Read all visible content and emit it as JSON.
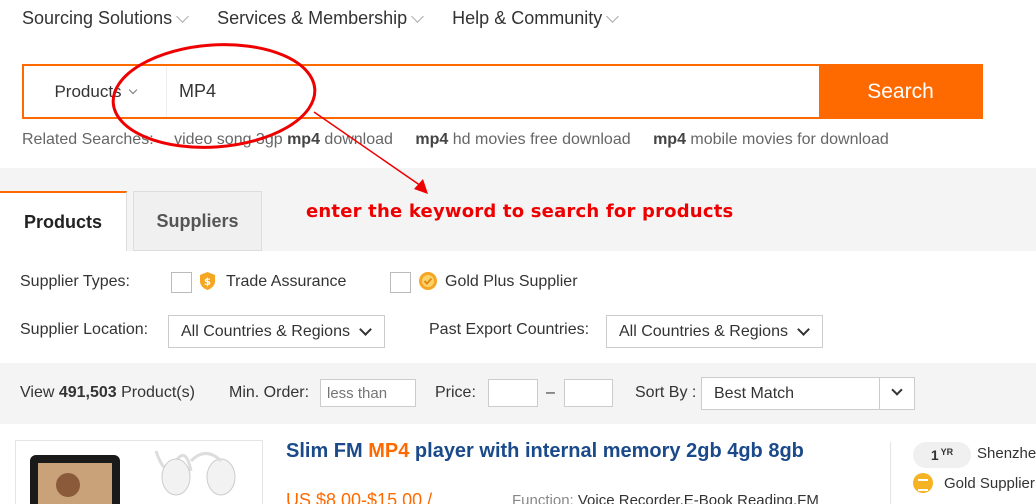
{
  "nav": {
    "items": [
      "Sourcing Solutions",
      "Services & Membership",
      "Help & Community"
    ]
  },
  "search": {
    "scope": "Products",
    "value": "MP4",
    "button": "Search"
  },
  "related": {
    "label": "Related Searches:",
    "items": [
      {
        "pre": "video song 3gp ",
        "bold": "mp4",
        "post": " download"
      },
      {
        "pre": "",
        "bold": "mp4",
        "post": " hd movies free download"
      },
      {
        "pre": "",
        "bold": "mp4",
        "post": " mobile movies for download"
      }
    ]
  },
  "annotation": {
    "text": "enter the keyword to search for products",
    "color": "#e00000"
  },
  "tabs": [
    "Products",
    "Suppliers"
  ],
  "filters": {
    "supplier_types_label": "Supplier Types:",
    "trade_assurance": "Trade Assurance",
    "gold_plus": "Gold Plus Supplier",
    "location_label": "Supplier Location:",
    "location_value": "All Countries & Regions",
    "export_label": "Past Export Countries:",
    "export_value": "All Countries & Regions"
  },
  "toolbar": {
    "view_pre": "View ",
    "count": "491,503",
    "view_post": " Product(s)",
    "min_order_label": "Min. Order:",
    "min_order_placeholder": "less than",
    "price_label": "Price:",
    "dash": "–",
    "sort_label": "Sort By :",
    "sort_value": "Best Match"
  },
  "product": {
    "title_pre": "Slim FM ",
    "title_hl": "MP4",
    "title_post": " player with internal memory 2gb 4gb 8gb",
    "price": "US $8.00-$15.00 /",
    "spec_key": "Function: ",
    "spec_val": "Voice Recorder,E-Book Reading,FM",
    "years": "1",
    "years_unit": "YR",
    "supplier": "Shenzhen",
    "gold": "Gold Supplier"
  },
  "colors": {
    "accent": "#ff6a00",
    "title_blue": "#1a4a8a"
  }
}
